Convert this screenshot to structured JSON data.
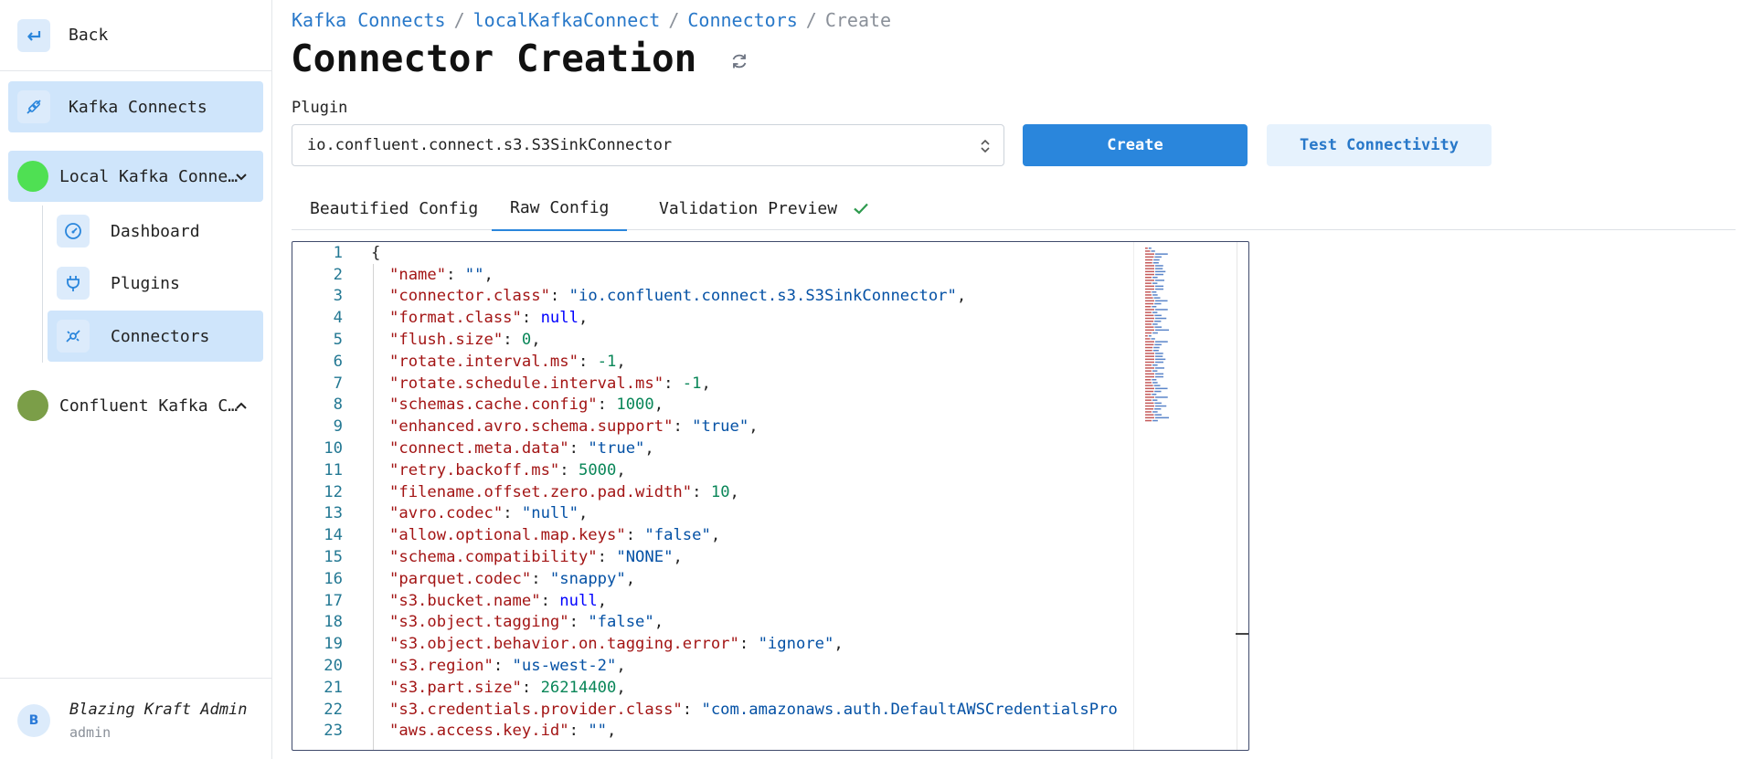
{
  "sidebar": {
    "back_label": "Back",
    "kafka_connects_label": "Kafka Connects",
    "connects": [
      {
        "label": "Local Kafka Conne…",
        "color": "#4fe053",
        "expanded": true
      },
      {
        "label": "Confluent Kafka C…",
        "color": "#7b9e48",
        "expanded": false
      }
    ],
    "sub_items": [
      {
        "label": "Dashboard",
        "icon": "gauge-icon"
      },
      {
        "label": "Plugins",
        "icon": "plug-icon"
      },
      {
        "label": "Connectors",
        "icon": "connectors-icon"
      }
    ],
    "user": {
      "initial": "B",
      "name": "Blazing Kraft Admin",
      "role": "admin"
    }
  },
  "breadcrumb": {
    "items": [
      "Kafka Connects",
      "localKafkaConnect",
      "Connectors"
    ],
    "current": "Create",
    "separator": "/"
  },
  "page": {
    "title": "Connector Creation"
  },
  "plugin": {
    "label": "Plugin",
    "value": "io.confluent.connect.s3.S3SinkConnector"
  },
  "buttons": {
    "create": "Create",
    "test": "Test Connectivity"
  },
  "tabs": [
    {
      "label": "Beautified Config",
      "active": false
    },
    {
      "label": "Raw Config",
      "active": true
    },
    {
      "label": "Validation Preview",
      "active": false,
      "valid": true
    }
  ],
  "colors": {
    "accent": "#2a86dc",
    "active_bg": "#cfe5fb",
    "success": "#2e9a4e"
  },
  "editor": {
    "lines": [
      {
        "n": "1",
        "parts": [
          [
            "p",
            "{"
          ]
        ]
      },
      {
        "n": "2",
        "parts": [
          [
            "k",
            "\"name\""
          ],
          [
            "p",
            ": "
          ],
          [
            "s",
            "\"\""
          ],
          [
            "p",
            ","
          ]
        ]
      },
      {
        "n": "3",
        "parts": [
          [
            "k",
            "\"connector.class\""
          ],
          [
            "p",
            ": "
          ],
          [
            "s",
            "\"io.confluent.connect.s3.S3SinkConnector\""
          ],
          [
            "p",
            ","
          ]
        ]
      },
      {
        "n": "4",
        "parts": [
          [
            "k",
            "\"format.class\""
          ],
          [
            "p",
            ": "
          ],
          [
            "s",
            "null"
          ],
          [
            "p",
            ","
          ]
        ]
      },
      {
        "n": "5",
        "parts": [
          [
            "k",
            "\"flush.size\""
          ],
          [
            "p",
            ": "
          ],
          [
            "n",
            "0"
          ],
          [
            "p",
            ","
          ]
        ]
      },
      {
        "n": "6",
        "parts": [
          [
            "k",
            "\"rotate.interval.ms\""
          ],
          [
            "p",
            ": "
          ],
          [
            "n",
            "-1"
          ],
          [
            "p",
            ","
          ]
        ]
      },
      {
        "n": "7",
        "parts": [
          [
            "k",
            "\"rotate.schedule.interval.ms\""
          ],
          [
            "p",
            ": "
          ],
          [
            "n",
            "-1"
          ],
          [
            "p",
            ","
          ]
        ]
      },
      {
        "n": "8",
        "parts": [
          [
            "k",
            "\"schemas.cache.config\""
          ],
          [
            "p",
            ": "
          ],
          [
            "n",
            "1000"
          ],
          [
            "p",
            ","
          ]
        ]
      },
      {
        "n": "9",
        "parts": [
          [
            "k",
            "\"enhanced.avro.schema.support\""
          ],
          [
            "p",
            ": "
          ],
          [
            "s",
            "\"true\""
          ],
          [
            "p",
            ","
          ]
        ]
      },
      {
        "n": "10",
        "parts": [
          [
            "k",
            "\"connect.meta.data\""
          ],
          [
            "p",
            ": "
          ],
          [
            "s",
            "\"true\""
          ],
          [
            "p",
            ","
          ]
        ]
      },
      {
        "n": "11",
        "parts": [
          [
            "k",
            "\"retry.backoff.ms\""
          ],
          [
            "p",
            ": "
          ],
          [
            "n",
            "5000"
          ],
          [
            "p",
            ","
          ]
        ]
      },
      {
        "n": "12",
        "parts": [
          [
            "k",
            "\"filename.offset.zero.pad.width\""
          ],
          [
            "p",
            ": "
          ],
          [
            "n",
            "10"
          ],
          [
            "p",
            ","
          ]
        ]
      },
      {
        "n": "13",
        "parts": [
          [
            "k",
            "\"avro.codec\""
          ],
          [
            "p",
            ": "
          ],
          [
            "s",
            "\"null\""
          ],
          [
            "p",
            ","
          ]
        ]
      },
      {
        "n": "14",
        "parts": [
          [
            "k",
            "\"allow.optional.map.keys\""
          ],
          [
            "p",
            ": "
          ],
          [
            "s",
            "\"false\""
          ],
          [
            "p",
            ","
          ]
        ]
      },
      {
        "n": "15",
        "parts": [
          [
            "k",
            "\"schema.compatibility\""
          ],
          [
            "p",
            ": "
          ],
          [
            "s",
            "\"NONE\""
          ],
          [
            "p",
            ","
          ]
        ]
      },
      {
        "n": "16",
        "parts": [
          [
            "k",
            "\"parquet.codec\""
          ],
          [
            "p",
            ": "
          ],
          [
            "s",
            "\"snappy\""
          ],
          [
            "p",
            ","
          ]
        ]
      },
      {
        "n": "17",
        "parts": [
          [
            "k",
            "\"s3.bucket.name\""
          ],
          [
            "p",
            ": "
          ],
          [
            "s",
            "null"
          ],
          [
            "p",
            ","
          ]
        ]
      },
      {
        "n": "18",
        "parts": [
          [
            "k",
            "\"s3.object.tagging\""
          ],
          [
            "p",
            ": "
          ],
          [
            "s",
            "\"false\""
          ],
          [
            "p",
            ","
          ]
        ]
      },
      {
        "n": "19",
        "parts": [
          [
            "k",
            "\"s3.object.behavior.on.tagging.error\""
          ],
          [
            "p",
            ": "
          ],
          [
            "s",
            "\"ignore\""
          ],
          [
            "p",
            ","
          ]
        ]
      },
      {
        "n": "20",
        "parts": [
          [
            "k",
            "\"s3.region\""
          ],
          [
            "p",
            ": "
          ],
          [
            "s",
            "\"us-west-2\""
          ],
          [
            "p",
            ","
          ]
        ]
      },
      {
        "n": "21",
        "parts": [
          [
            "k",
            "\"s3.part.size\""
          ],
          [
            "p",
            ": "
          ],
          [
            "n",
            "26214400"
          ],
          [
            "p",
            ","
          ]
        ]
      },
      {
        "n": "22",
        "parts": [
          [
            "k",
            "\"s3.credentials.provider.class\""
          ],
          [
            "p",
            ": "
          ],
          [
            "s",
            "\"com.amazonaws.auth.DefaultAWSCredentialsPro"
          ]
        ]
      },
      {
        "n": "23",
        "parts": [
          [
            "k",
            "\"aws.access.key.id\""
          ],
          [
            "p",
            ": "
          ],
          [
            "s",
            "\"\""
          ],
          [
            "p",
            ","
          ]
        ]
      }
    ]
  }
}
